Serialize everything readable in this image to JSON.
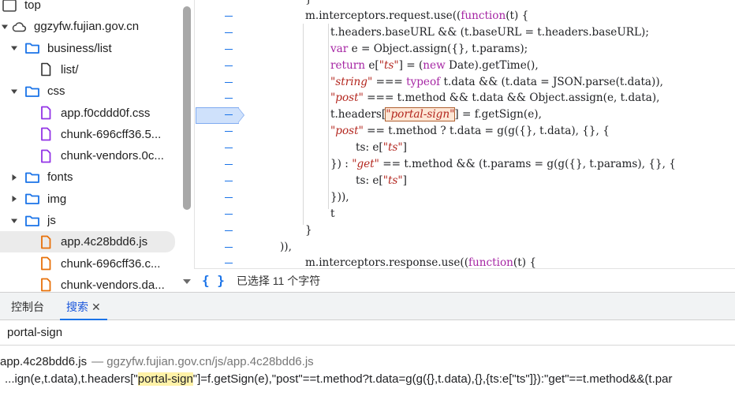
{
  "tree": {
    "items": [
      {
        "label": "top",
        "icon": "window-icon",
        "depth": 0,
        "chevron": "none"
      },
      {
        "label": "ggzyfw.fujian.gov.cn",
        "icon": "cloud-icon",
        "depth": 0,
        "chevron": "down"
      },
      {
        "label": "business/list",
        "icon": "folder-icon",
        "depth": 1,
        "chevron": "down"
      },
      {
        "label": "list/",
        "icon": "file-icon",
        "depth": 2,
        "chevron": "none"
      },
      {
        "label": "css",
        "icon": "folder-icon",
        "depth": 1,
        "chevron": "down"
      },
      {
        "label": "app.f0cddd0f.css",
        "icon": "css-file-icon",
        "depth": 2,
        "chevron": "none"
      },
      {
        "label": "chunk-696cff36.5...",
        "icon": "css-file-icon",
        "depth": 2,
        "chevron": "none"
      },
      {
        "label": "chunk-vendors.0c...",
        "icon": "css-file-icon",
        "depth": 2,
        "chevron": "none"
      },
      {
        "label": "fonts",
        "icon": "folder-icon",
        "depth": 1,
        "chevron": "right"
      },
      {
        "label": "img",
        "icon": "folder-icon",
        "depth": 1,
        "chevron": "right"
      },
      {
        "label": "js",
        "icon": "folder-icon",
        "depth": 1,
        "chevron": "down"
      },
      {
        "label": "app.4c28bdd6.js",
        "icon": "js-file-icon",
        "depth": 2,
        "chevron": "none",
        "selected": true
      },
      {
        "label": "chunk-696cff36.c...",
        "icon": "js-file-icon",
        "depth": 2,
        "chevron": "none"
      },
      {
        "label": "chunk-vendors.da...",
        "icon": "js-file-icon",
        "depth": 2,
        "chevron": "none"
      }
    ]
  },
  "editor": {
    "lines": [
      [
        {
          "t": "}",
          "c": ""
        }
      ],
      [
        {
          "t": "m.interceptors.request.use((",
          "c": ""
        },
        {
          "t": "function",
          "c": "k"
        },
        {
          "t": "(t) {",
          "c": ""
        }
      ],
      [
        {
          "t": "t.headers.baseURL && (t.baseURL = t.headers.baseURL);",
          "c": ""
        }
      ],
      [
        {
          "t": "var",
          "c": "k"
        },
        {
          "t": " e = Object.assign({}, t.params);",
          "c": ""
        }
      ],
      [
        {
          "t": "return",
          "c": "k"
        },
        {
          "t": " e[",
          "c": ""
        },
        {
          "t": "\"ts\"",
          "c": "s"
        },
        {
          "t": "] = (",
          "c": ""
        },
        {
          "t": "new",
          "c": "k"
        },
        {
          "t": " Date).getTime(),",
          "c": ""
        }
      ],
      [
        {
          "t": "\"string\"",
          "c": "s"
        },
        {
          "t": " === ",
          "c": ""
        },
        {
          "t": "typeof",
          "c": "k"
        },
        {
          "t": " t.data && (t.data = JSON.parse(t.data)),",
          "c": ""
        }
      ],
      [
        {
          "t": "\"post\"",
          "c": "s"
        },
        {
          "t": " === t.method && t.data && Object.assign(e, t.data),",
          "c": ""
        }
      ],
      [
        {
          "t": "t.headers[",
          "c": ""
        },
        {
          "t": "\"portal-sign\"",
          "c": "s hl"
        },
        {
          "t": "] = f.getSign(e),",
          "c": ""
        }
      ],
      [
        {
          "t": "\"post\"",
          "c": "s"
        },
        {
          "t": " == t.method ? t.data = g(g({}, t.data), {}, {",
          "c": ""
        }
      ],
      [
        {
          "t": "ts: e[",
          "c": ""
        },
        {
          "t": "\"ts\"",
          "c": "s"
        },
        {
          "t": "]",
          "c": ""
        }
      ],
      [
        {
          "t": "}) : ",
          "c": ""
        },
        {
          "t": "\"get\"",
          "c": "s"
        },
        {
          "t": " == t.method && (t.params = g(g({}, t.params), {}, {",
          "c": ""
        }
      ],
      [
        {
          "t": "ts: e[",
          "c": ""
        },
        {
          "t": "\"ts\"",
          "c": "s"
        },
        {
          "t": "]",
          "c": ""
        }
      ],
      [
        {
          "t": "})),",
          "c": ""
        }
      ],
      [
        {
          "t": "t",
          "c": ""
        }
      ],
      [
        {
          "t": "}",
          "c": ""
        }
      ],
      [
        {
          "t": ")),",
          "c": ""
        }
      ],
      [
        {
          "t": "m.interceptors.response.use((",
          "c": ""
        },
        {
          "t": "function",
          "c": "k"
        },
        {
          "t": "(t) {",
          "c": ""
        }
      ]
    ]
  },
  "status": {
    "braces": "{ }",
    "selection": "已选择 11 个字符"
  },
  "drawer": {
    "tabs": {
      "console": "控制台",
      "search": "搜索",
      "close": "✕"
    },
    "search_query": "portal-sign",
    "result": {
      "file": "app.4c28bdd6.js",
      "path": "— ggzyfw.fujian.gov.cn/js/app.4c28bdd6.js",
      "prefix": "...ign(e,t.data),t.headers[\"",
      "match": "portal-sign",
      "suffix": "\"]=f.getSign(e),\"post\"==t.method?t.data=g(g({},t.data),{},{ts:e[\"ts\"]}):\"get\"==t.method&&(t.par"
    }
  },
  "colors": {
    "accent": "#1a73e8",
    "keyword": "#a626a4",
    "string": "#b3261e",
    "folder": "#1a73e8",
    "css_file": "#9334e6",
    "js_file": "#e8710a"
  }
}
